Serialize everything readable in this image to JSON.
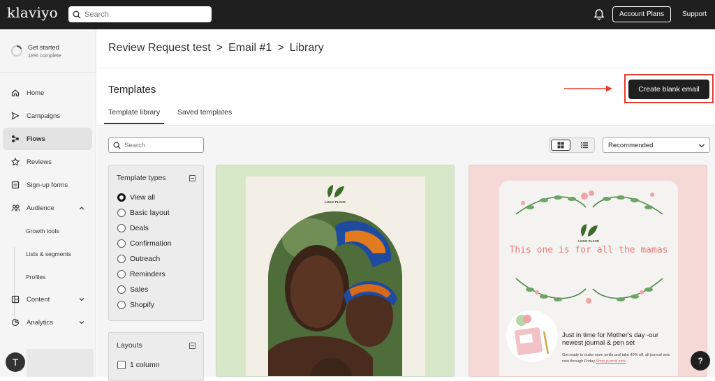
{
  "topbar": {
    "logo": "klaviyo",
    "search_placeholder": "Search",
    "account_plans": "Account Plans",
    "support": "Support"
  },
  "sidebar": {
    "get_started": {
      "title": "Get started",
      "progress_label": "18% complete",
      "progress": 0.18
    },
    "items": [
      {
        "label": "Home",
        "icon": "home-icon"
      },
      {
        "label": "Campaigns",
        "icon": "send-icon"
      },
      {
        "label": "Flows",
        "icon": "flows-icon",
        "active": true
      },
      {
        "label": "Reviews",
        "icon": "star-icon"
      },
      {
        "label": "Sign-up forms",
        "icon": "form-icon"
      },
      {
        "label": "Audience",
        "icon": "people-icon",
        "expanded": true
      },
      {
        "label": "Content",
        "icon": "content-icon"
      },
      {
        "label": "Analytics",
        "icon": "analytics-icon"
      }
    ],
    "audience_sub": [
      "Growth tools",
      "Lists & segments",
      "Profiles"
    ],
    "avatar_letter": "T"
  },
  "breadcrumb": [
    "Review Request test",
    ">",
    "Email #1",
    ">",
    "Library"
  ],
  "page": {
    "title": "Templates",
    "create_button": "Create blank email",
    "tabs": [
      {
        "label": "Template library",
        "active": true
      },
      {
        "label": "Saved templates",
        "active": false
      }
    ]
  },
  "library": {
    "search_placeholder": "Search",
    "sort_value": "Recommended",
    "view_mode": "grid"
  },
  "filters": {
    "template_types": {
      "title": "Template types",
      "options": [
        "View all",
        "Basic layout",
        "Deals",
        "Confirmation",
        "Outreach",
        "Reminders",
        "Sales",
        "Shopify"
      ],
      "selected": "View all"
    },
    "layouts": {
      "title": "Layouts",
      "options": [
        "1 column"
      ]
    }
  },
  "cards": [
    {
      "logo_text": "LOGO PLACE",
      "bg": "#d7e8c9"
    },
    {
      "logo_text": "LOGO PLACE",
      "headline": "This one is for all the mamas",
      "promo_title": "Just in time for Mother's day -our newest journal & pen set",
      "promo_body": "Get ready to make mom smile and take 40% off, all journal sets now through Friday.",
      "promo_link": "Shop journal sets",
      "bg": "#f5d9d6"
    }
  ],
  "help_label": "?",
  "colors": {
    "accent_highlight": "#e53b2c",
    "topbar": "#1f1f1f"
  }
}
